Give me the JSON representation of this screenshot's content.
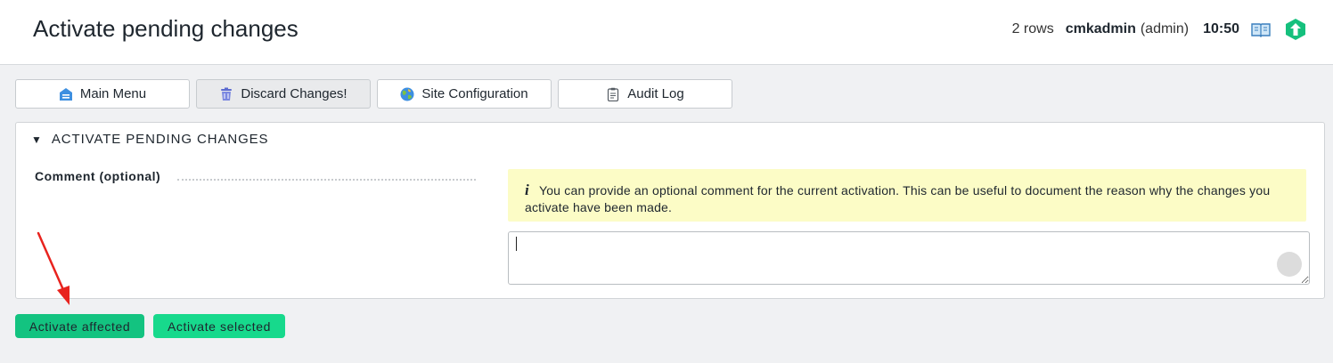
{
  "header": {
    "title": "Activate pending changes",
    "rows": "2 rows",
    "user": "cmkadmin",
    "role": "(admin)",
    "time": "10:50",
    "icons": [
      "book-icon",
      "checkmk-logo-icon"
    ]
  },
  "toolbar": {
    "buttons": [
      {
        "label": "Main Menu",
        "icon": "home-icon"
      },
      {
        "label": "Discard Changes!",
        "icon": "trash-icon"
      },
      {
        "label": "Site Configuration",
        "icon": "globe-icon"
      },
      {
        "label": "Audit Log",
        "icon": "clipboard-icon"
      }
    ]
  },
  "panel": {
    "heading": "ACTIVATE PENDING CHANGES",
    "comment_label": "Comment (optional)",
    "info_text": "You can provide an optional comment for the current activation. This can be useful to document the reason why the changes you activate have been made.",
    "comment_value": ""
  },
  "actions": {
    "affected_label": "Activate affected",
    "selected_label": "Activate selected"
  },
  "colors": {
    "accent_green": "#13c380",
    "info_background": "#fcfcc6",
    "annotation_arrow": "#e8231e"
  }
}
